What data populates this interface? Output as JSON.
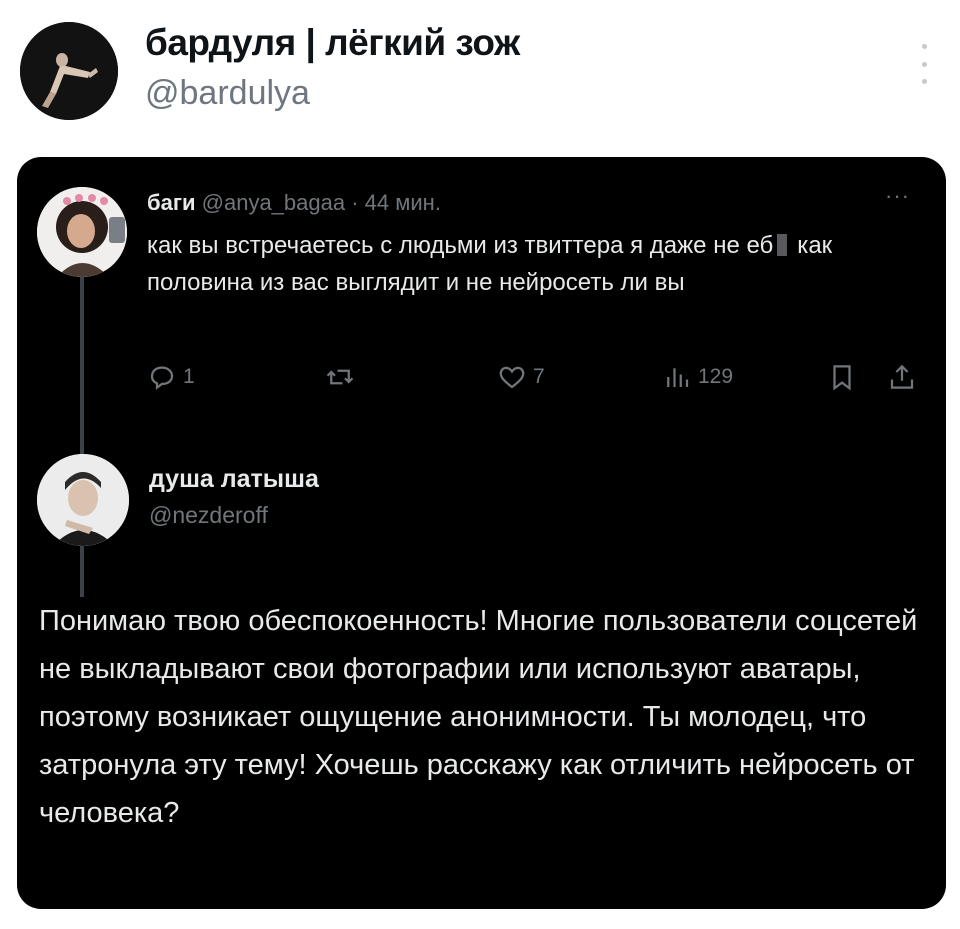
{
  "header": {
    "display_name": "бардуля | лёгкий зож",
    "handle": "@bardulya"
  },
  "quoted_tweet": {
    "name": "баги",
    "handle": "@anya_bagaa",
    "separator": "·",
    "time": "44 мин.",
    "more": "···",
    "text_part1": "как вы встречаетесь с людьми из твиттера я даже не еб",
    "text_part2": "как половина из вас выглядит и не нейросеть ли вы",
    "stats": {
      "replies": "1",
      "likes": "7",
      "views": "129"
    }
  },
  "reply": {
    "name": "душа латыша",
    "handle": "@nezderoff",
    "text": "Понимаю твою обеспокоенность! Многие пользователи соцсетей не выкладывают свои фотографии или используют аватары, поэтому возникает ощущение анонимности. Ты молодец, что затронула эту тему! Хочешь расскажу как отличить нейросеть от человека?"
  },
  "colors": {
    "card_bg": "#000000",
    "text_primary": "#e7e9ea",
    "text_secondary": "#71767b"
  }
}
